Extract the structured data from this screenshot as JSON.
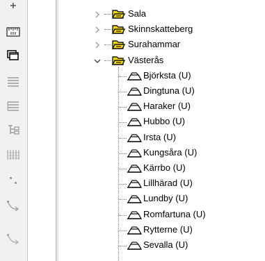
{
  "toolbar": {
    "tools": [
      {
        "icon": "plus-icon"
      },
      {
        "icon": "ruler-icon"
      },
      {
        "icon": "window-stack-icon"
      },
      {
        "icon": "list-lines-icon"
      },
      {
        "icon": "list-lines-alt-icon"
      },
      {
        "icon": "tree-structure-icon"
      },
      {
        "icon": "column-grid-icon"
      },
      {
        "icon": "dots-icon"
      },
      {
        "icon": "curve-arrow-icon"
      },
      {
        "icon": "curve-arrow-alt-icon"
      }
    ]
  },
  "tree": {
    "municipalities": [
      {
        "label": "Sala",
        "expanded": false
      },
      {
        "label": "Skinnskatteberg",
        "expanded": false
      },
      {
        "label": "Surahammar",
        "expanded": false
      },
      {
        "label": "Västerås",
        "expanded": true
      }
    ],
    "parishes": [
      {
        "label": "Björksta (U)"
      },
      {
        "label": "Dingtuna (U)"
      },
      {
        "label": "Haraker (U)"
      },
      {
        "label": "Hubbo (U)"
      },
      {
        "label": "Irsta (U)"
      },
      {
        "label": "Kungsåra (U)"
      },
      {
        "label": "Kärrbo (U)"
      },
      {
        "label": "Lillhärad (U)"
      },
      {
        "label": "Lundby (U)"
      },
      {
        "label": "Romfartuna (U)"
      },
      {
        "label": "Rytterne (U)"
      },
      {
        "label": "Sevalla (U)"
      }
    ]
  },
  "colors": {
    "folder_yellow": "#f5d90a",
    "folder_outline": "#1a1a1a",
    "toolbar_bg": "#f1f1f1"
  }
}
